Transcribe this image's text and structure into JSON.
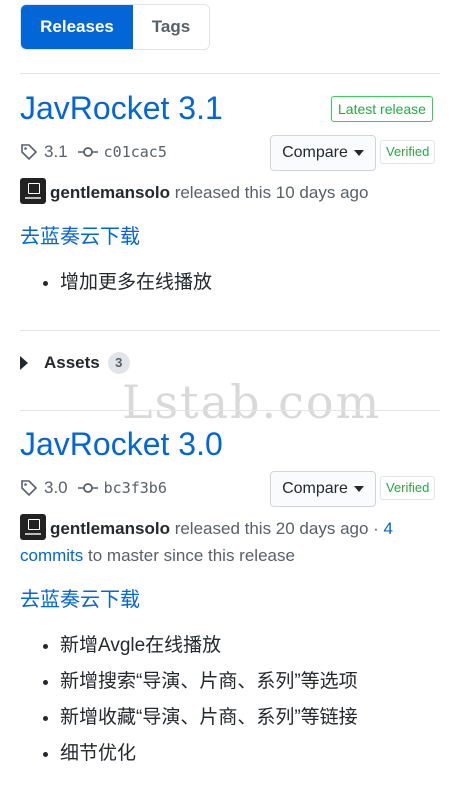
{
  "tabs": {
    "releases": "Releases",
    "tags": "Tags"
  },
  "releases": [
    {
      "title": "JavRocket 3.1",
      "latest_badge": "Latest release",
      "tag": "3.1",
      "commit": "c01cac5",
      "compare_label": "Compare",
      "verified_label": "Verified",
      "author": "gentlemansolo",
      "released_text": " released this 10 days ago",
      "download_link": "去蓝奏云下载",
      "notes": [
        "增加更多在线播放"
      ]
    },
    {
      "title": "JavRocket 3.0",
      "tag": "3.0",
      "commit": "bc3f3b6",
      "compare_label": "Compare",
      "verified_label": "Verified",
      "author": "gentlemansolo",
      "released_text": " released this 20 days ago · ",
      "commits_link": "4 commits",
      "since_text": " to master since this release",
      "download_link": "去蓝奏云下载",
      "notes": [
        "新增Avgle在线播放",
        "新增搜索“导演、片商、系列”等选项",
        "新增收藏“导演、片商、系列”等链接",
        "细节优化"
      ]
    }
  ],
  "assets": {
    "label": "Assets",
    "count": "3"
  },
  "watermark": "Lstab.com",
  "colors": {
    "accent": "#0366d6",
    "success": "#28a745",
    "border": "#e1e4e8"
  }
}
